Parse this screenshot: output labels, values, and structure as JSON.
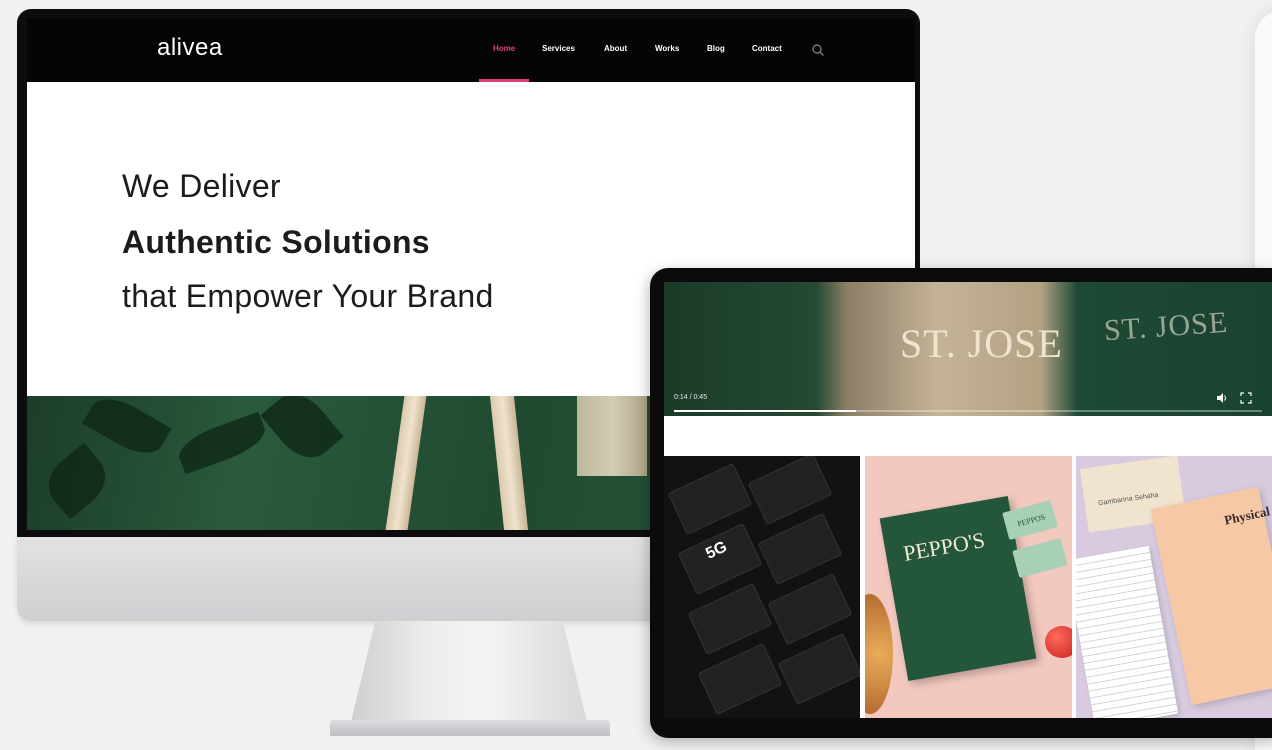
{
  "brand": {
    "logo": "alivea",
    "accent": "#e53d7a"
  },
  "nav": {
    "items": [
      {
        "label": "Home",
        "active": true
      },
      {
        "label": "Services"
      },
      {
        "label": "About"
      },
      {
        "label": "Works"
      },
      {
        "label": "Blog"
      },
      {
        "label": "Contact"
      }
    ],
    "search_icon": "search-icon"
  },
  "hero": {
    "line1": "We Deliver",
    "line2": "Authentic Solutions",
    "line3": "that Empower Your Brand"
  },
  "tablet": {
    "video": {
      "bag_text": "ST. JOSE",
      "bag_text_side": "ST. JOSE",
      "time": "0:14 / 0:45",
      "progress": 0.31,
      "controls": [
        "volume-icon",
        "fullscreen-icon"
      ]
    },
    "tiles": {
      "tech": {
        "label": "5G"
      },
      "peppos": {
        "title": "PEPPO'S",
        "card": "PEPPOS"
      },
      "physical": {
        "title": "Physical",
        "note": "Gambarina Sehaha"
      }
    }
  }
}
